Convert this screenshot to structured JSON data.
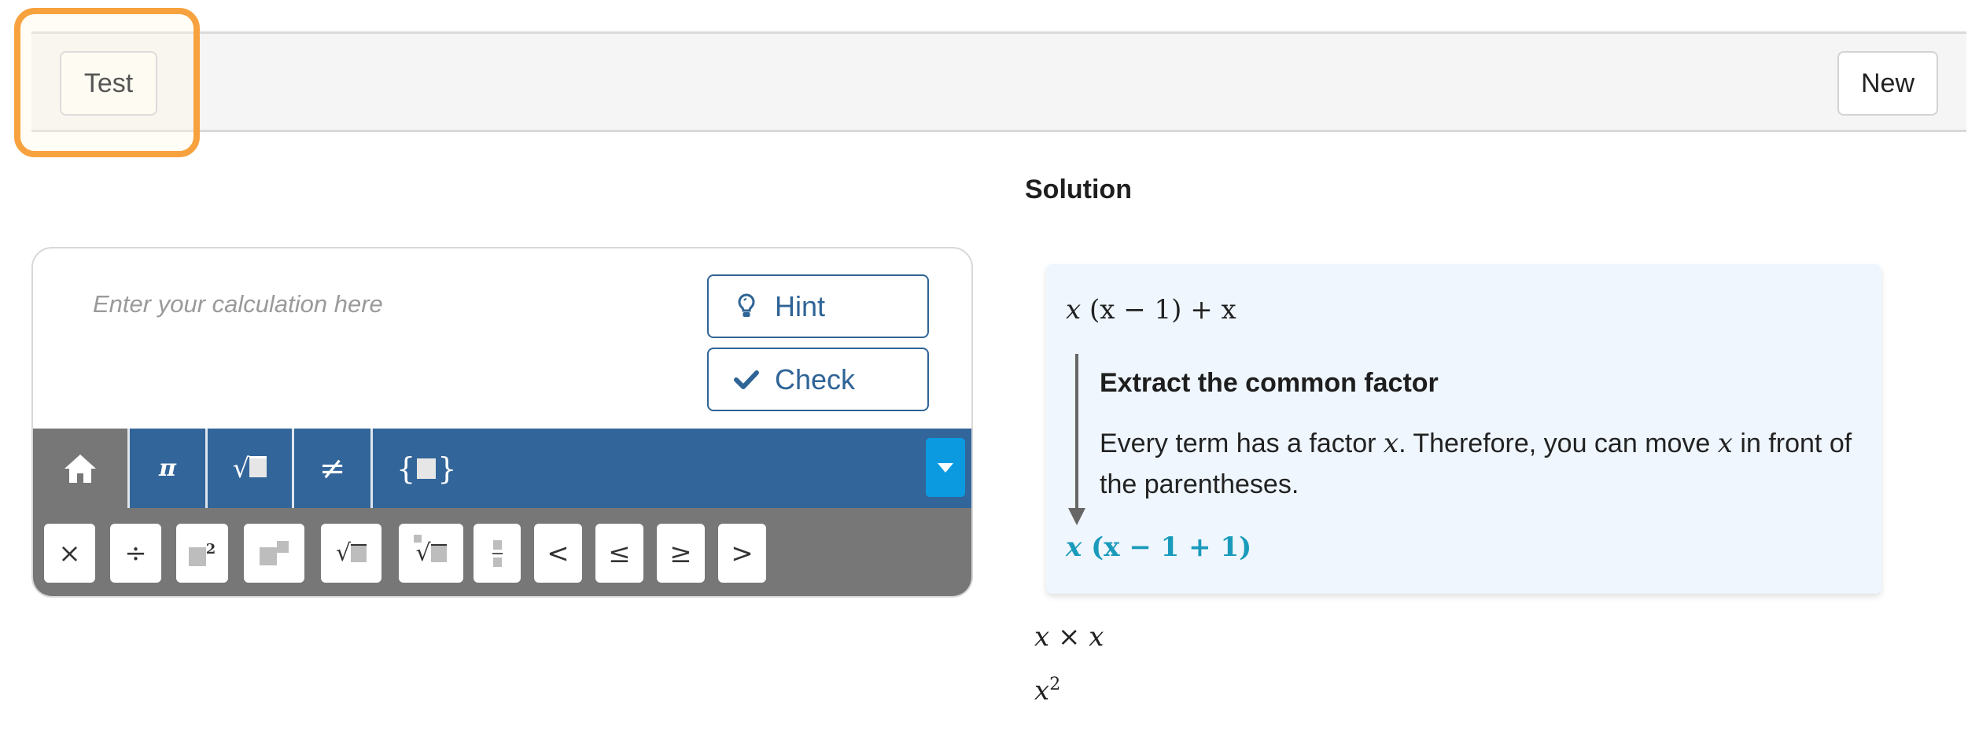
{
  "topbar": {
    "test_label": "Test",
    "new_label": "New"
  },
  "calculator": {
    "input_placeholder": "Enter your calculation here",
    "input_value": "",
    "hint_label": "Hint",
    "check_label": "Check",
    "tabs": [
      {
        "name": "home",
        "icon": "home-icon"
      },
      {
        "name": "constants",
        "symbol": "π"
      },
      {
        "name": "roots",
        "symbol": "√■"
      },
      {
        "name": "relations",
        "symbol": "≠"
      },
      {
        "name": "sets",
        "symbol": "{■}"
      }
    ],
    "tab_symbols": {
      "pi": "π",
      "sqrt": "√",
      "neq": "≠",
      "set_open": "{",
      "set_close": "}"
    },
    "keys": {
      "times": "×",
      "divide": "÷",
      "square_exp": "2",
      "sqrt": "√",
      "nthroot": "√",
      "less": "<",
      "leq": "≤",
      "geq": "≥",
      "greater": ">"
    },
    "colors": {
      "toolbar": "#326599",
      "keyboard": "#777777",
      "dropdown": "#0b9ae0",
      "button_text": "#2f6496"
    }
  },
  "solution": {
    "title": "Solution",
    "step": {
      "before": {
        "a": "x",
        "b": "(x − 1) + x"
      },
      "title": "Extract the common factor",
      "desc_1": "Every term has a factor ",
      "desc_var": "x",
      "desc_2": ". Therefore, you can move ",
      "desc_var2": "x",
      "desc_3": " in front of the parentheses.",
      "after": {
        "a": "x",
        "b": "(x − 1 + 1)"
      },
      "highlight_color": "#1a9bbb"
    },
    "line_1": "x × x",
    "line_2_base": "x",
    "line_2_exp": "2"
  }
}
